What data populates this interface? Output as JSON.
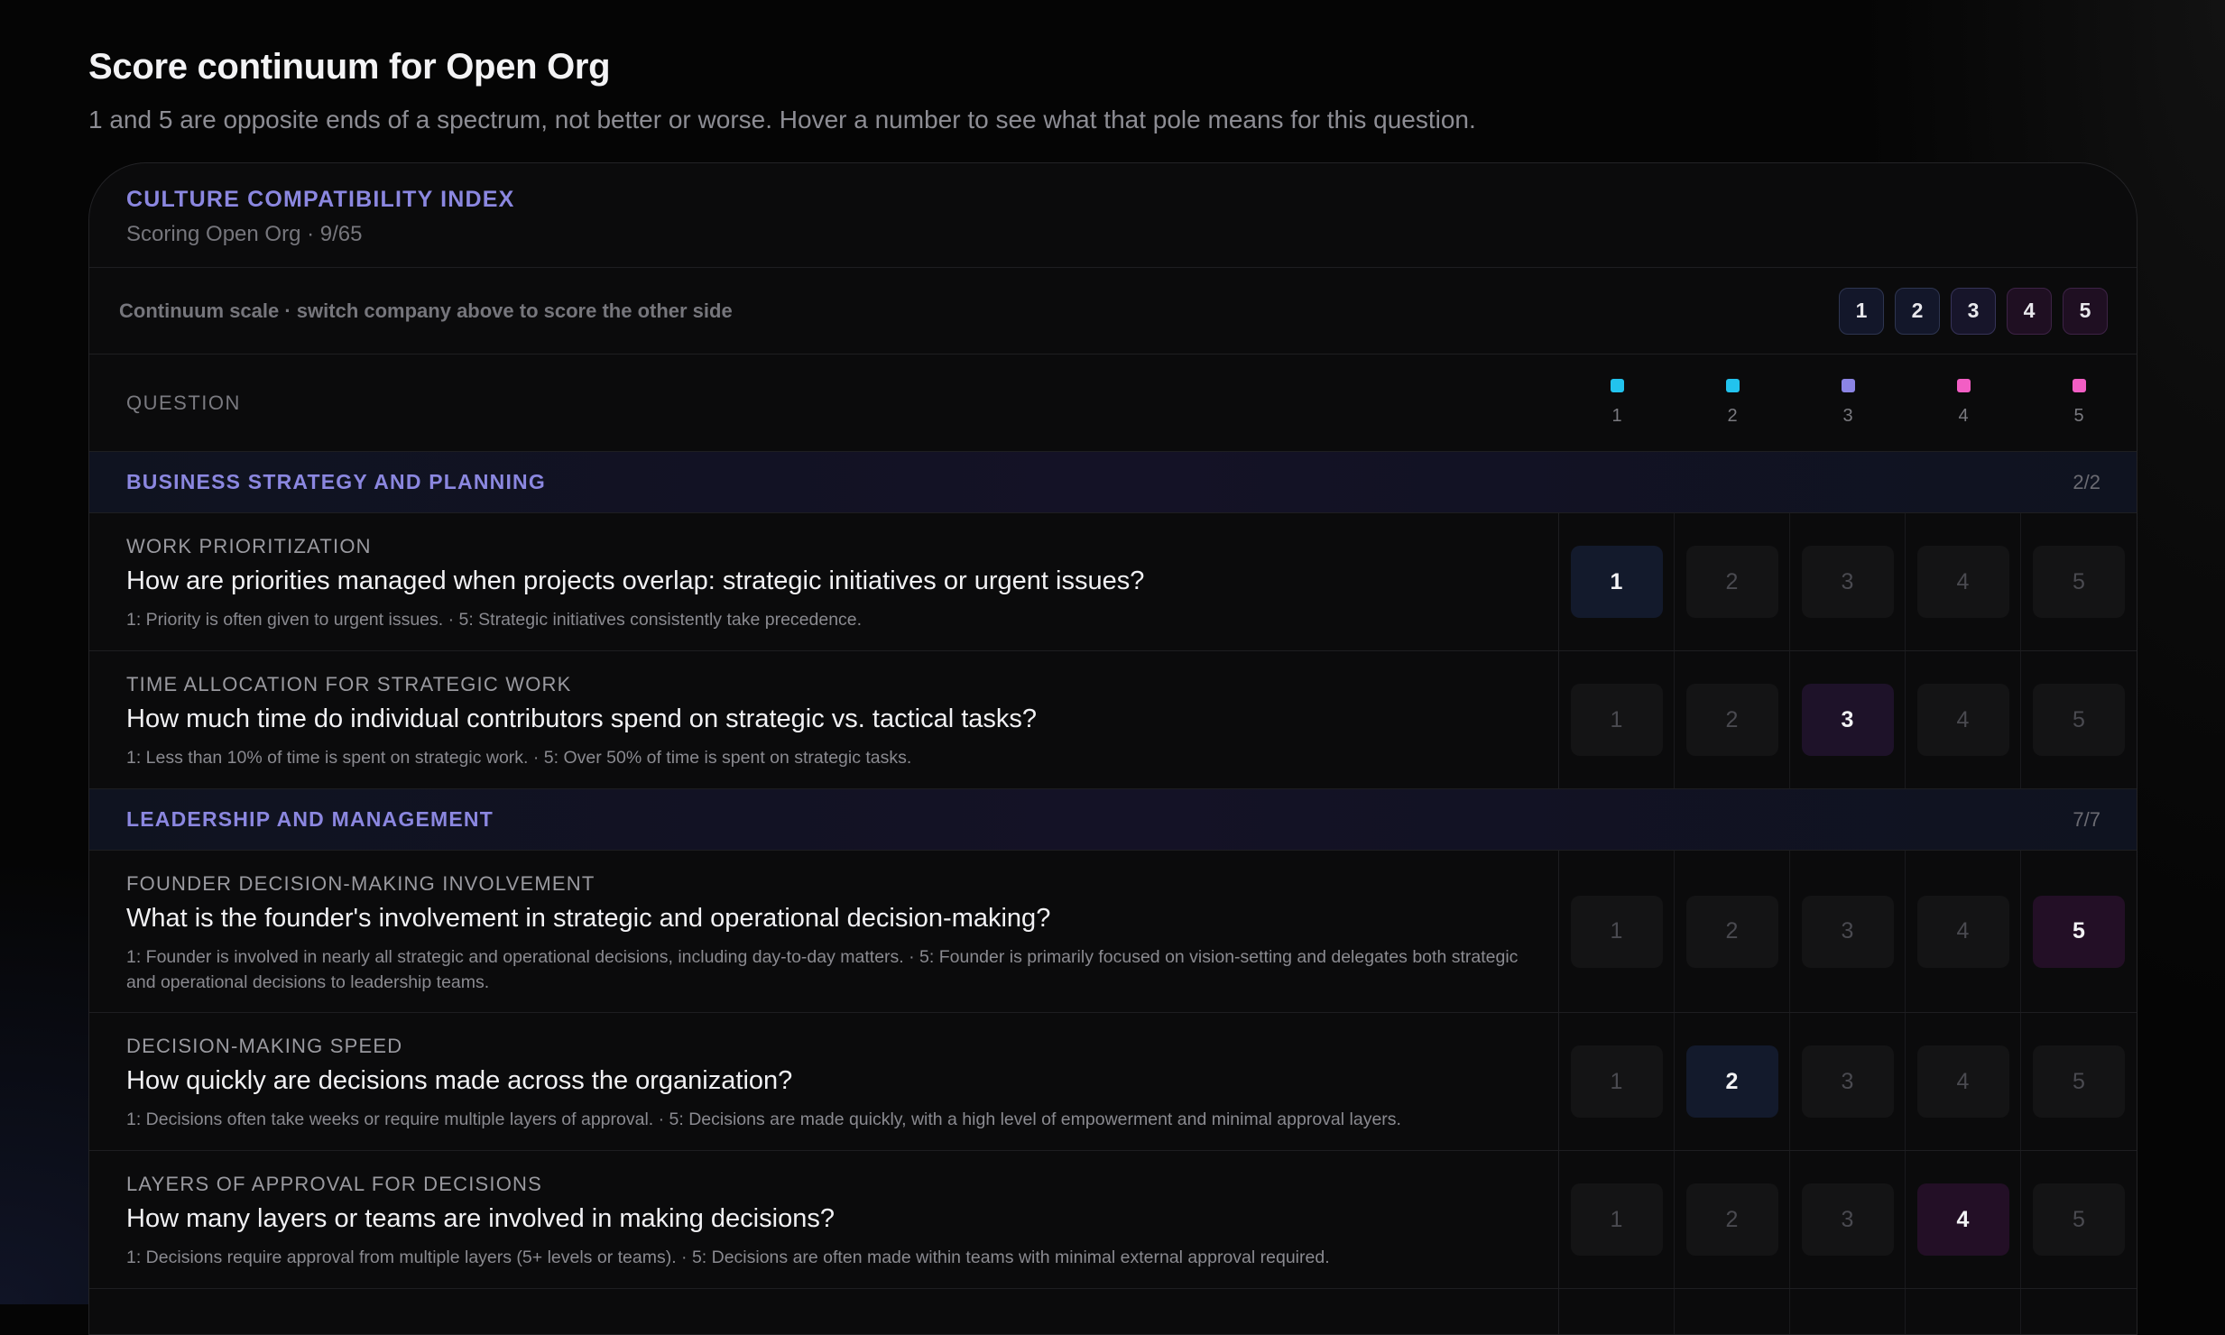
{
  "page": {
    "title": "Score continuum for Open Org",
    "subtitle": "1 and 5 are opposite ends of a spectrum, not better or worse. Hover a number to see what that pole means for this question."
  },
  "card": {
    "eyebrow": "CULTURE COMPATIBILITY INDEX",
    "subtitle": "Scoring Open Org · 9/65"
  },
  "toolbar": {
    "label": "Continuum scale · switch company above to score the other side",
    "scale": [
      "1",
      "2",
      "3",
      "4",
      "5"
    ]
  },
  "columns": {
    "question_label": "QUESTION",
    "legend": [
      {
        "num": "1",
        "color": "#22c3ee"
      },
      {
        "num": "2",
        "color": "#22c3ee"
      },
      {
        "num": "3",
        "color": "#8b84e4"
      },
      {
        "num": "4",
        "color": "#f25ec4"
      },
      {
        "num": "5",
        "color": "#f25ec4"
      }
    ]
  },
  "option_labels": [
    "1",
    "2",
    "3",
    "4",
    "5"
  ],
  "sections": [
    {
      "title": "BUSINESS STRATEGY AND PLANNING",
      "count": "2/2",
      "rows": [
        {
          "label": "WORK PRIORITIZATION",
          "question": "How are priorities managed when projects overlap: strategic initiatives or urgent issues?",
          "desc": "1: Priority is often given to urgent issues. · 5: Strategic initiatives consistently take precedence.",
          "selected": 1
        },
        {
          "label": "TIME ALLOCATION FOR STRATEGIC WORK",
          "question": "How much time do individual contributors spend on strategic vs. tactical tasks?",
          "desc": "1: Less than 10% of time is spent on strategic work. · 5: Over 50% of time is spent on strategic tasks.",
          "selected": 3
        }
      ]
    },
    {
      "title": "LEADERSHIP AND MANAGEMENT",
      "count": "7/7",
      "rows": [
        {
          "label": "FOUNDER DECISION-MAKING INVOLVEMENT",
          "question": "What is the founder's involvement in strategic and operational decision-making?",
          "desc": "1: Founder is involved in nearly all strategic and operational decisions, including day-to-day matters. · 5: Founder is primarily focused on vision-setting and delegates both strategic and operational decisions to leadership teams.",
          "selected": 5
        },
        {
          "label": "DECISION-MAKING SPEED",
          "question": "How quickly are decisions made across the organization?",
          "desc": "1: Decisions often take weeks or require multiple layers of approval. · 5: Decisions are made quickly, with a high level of empowerment and minimal approval layers.",
          "selected": 2
        },
        {
          "label": "LAYERS OF APPROVAL FOR DECISIONS",
          "question": "How many layers or teams are involved in making decisions?",
          "desc": "1: Decisions require approval from multiple layers (5+ levels or teams). · 5: Decisions are often made within teams with minimal external approval required.",
          "selected": 4
        }
      ]
    }
  ]
}
